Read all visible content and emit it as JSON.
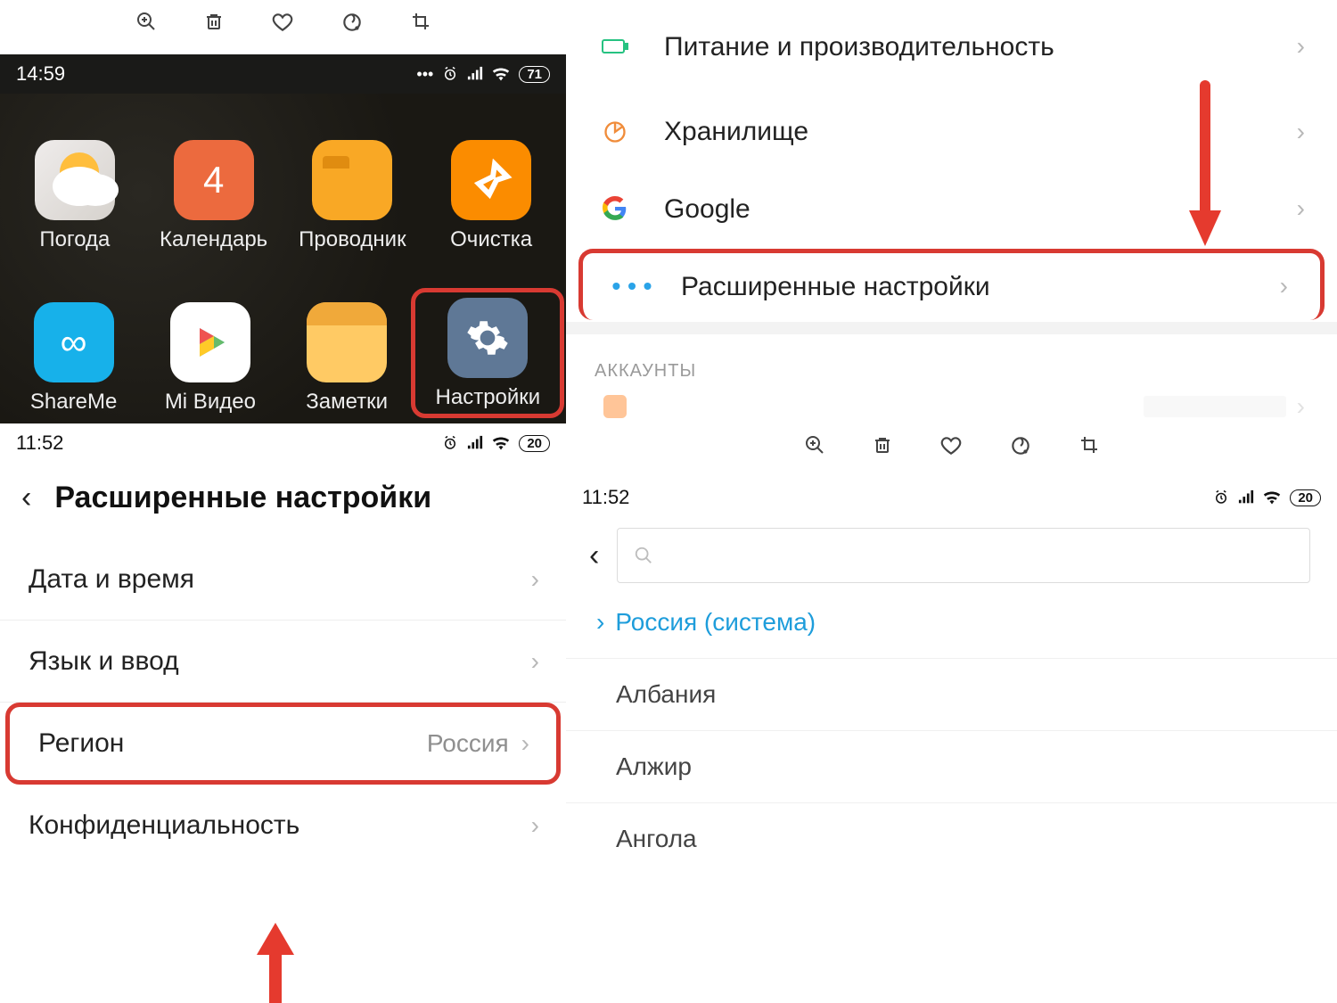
{
  "viewer_toolbar": {
    "zoom": "zoom-icon",
    "delete": "delete-icon",
    "favorite": "favorite-icon",
    "edit": "edit-icon",
    "crop": "crop-icon"
  },
  "q1": {
    "status": {
      "time": "14:59",
      "battery": "71"
    },
    "apps_row1": [
      {
        "id": "weather",
        "label": "Погода"
      },
      {
        "id": "calendar",
        "label": "Календарь",
        "digit": "4"
      },
      {
        "id": "explorer",
        "label": "Проводник"
      },
      {
        "id": "cleaner",
        "label": "Очистка"
      }
    ],
    "apps_row2": [
      {
        "id": "shareme",
        "label": "ShareMe",
        "glyph": "∞"
      },
      {
        "id": "mivideo",
        "label": "Mi Видео"
      },
      {
        "id": "notes",
        "label": "Заметки"
      },
      {
        "id": "settings",
        "label": "Настройки"
      }
    ]
  },
  "q2": {
    "items": {
      "power": "Питание и производительность",
      "storage": "Хранилище",
      "google": "Google",
      "advanced": "Расширенные настройки"
    },
    "section_accounts": "АККАУНТЫ"
  },
  "q3": {
    "status": {
      "time": "11:52",
      "battery": "20"
    },
    "title": "Расширенные настройки",
    "items": {
      "datetime": "Дата и время",
      "langinput": "Язык и ввод",
      "region": "Регион",
      "region_value": "Россия",
      "privacy": "Конфиденциальность"
    }
  },
  "q4": {
    "status": {
      "time": "11:52",
      "battery": "20"
    },
    "current": "Россия (система)",
    "list": [
      "Албания",
      "Алжир",
      "Ангола"
    ]
  }
}
